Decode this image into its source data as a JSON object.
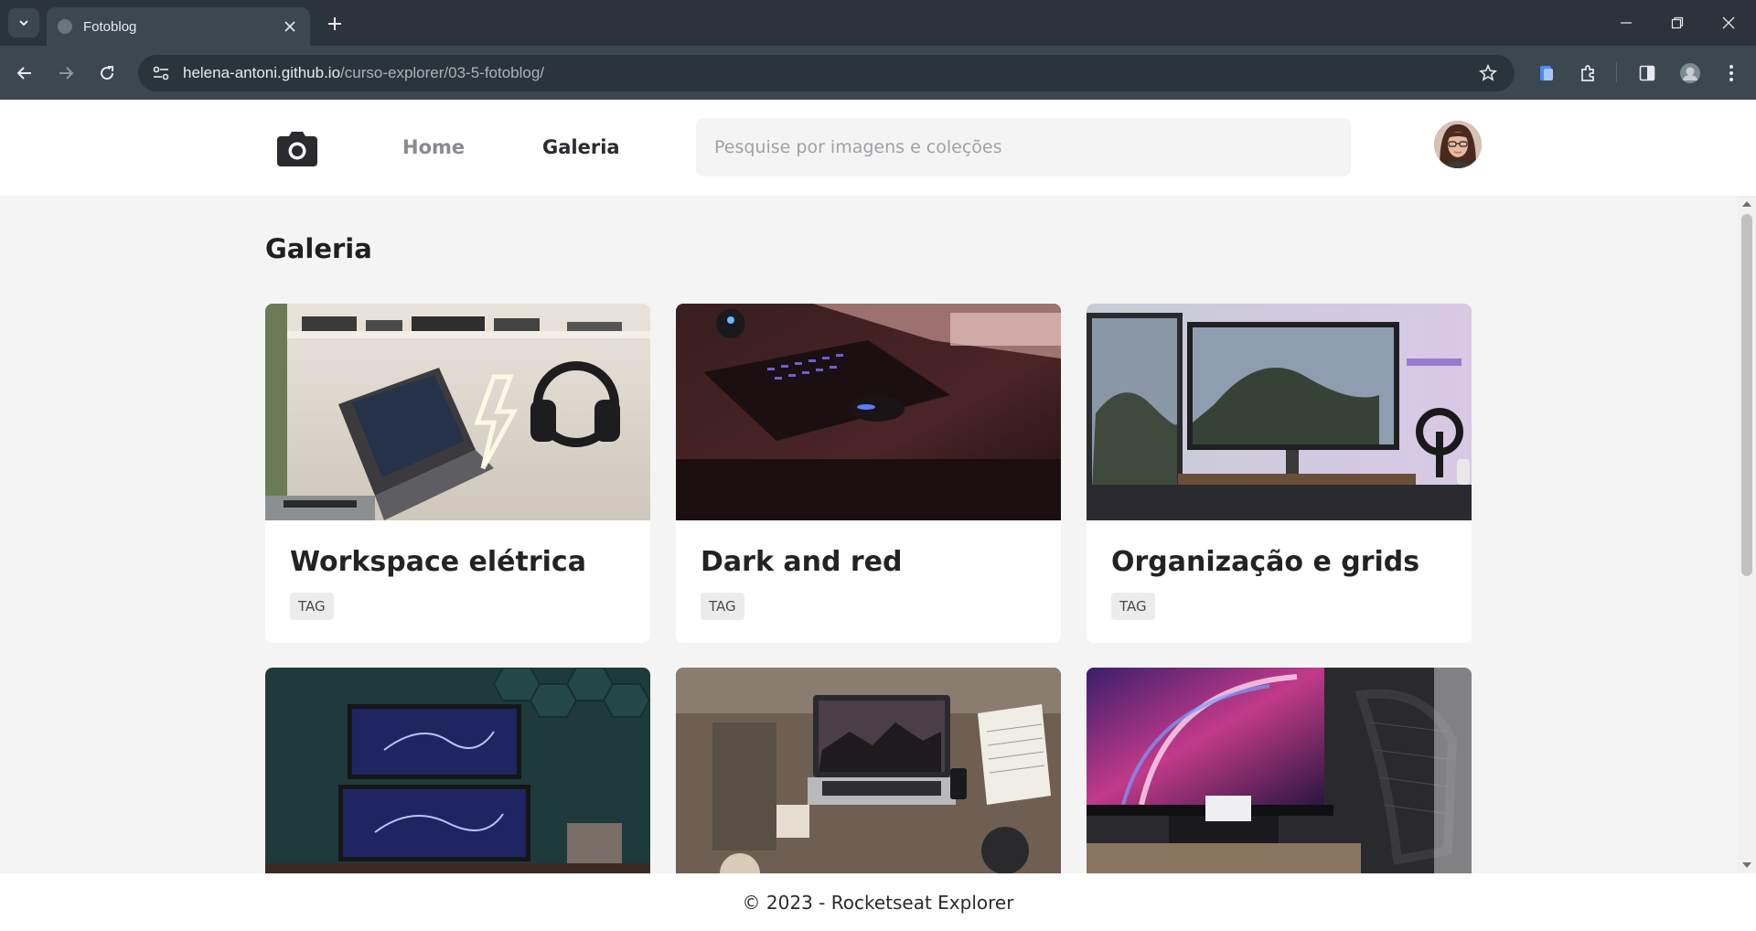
{
  "browser": {
    "tab_title": "Fotoblog",
    "url_host": "helena-antoni.github.io",
    "url_path": "/curso-explorer/03-5-fotoblog/"
  },
  "header": {
    "nav": [
      {
        "label": "Home",
        "active": false
      },
      {
        "label": "Galeria",
        "active": true
      }
    ],
    "search_placeholder": "Pesquise por imagens e coleções"
  },
  "main": {
    "title": "Galeria",
    "cards": [
      {
        "title": "Workspace elétrica",
        "tag": "TAG",
        "image": "desk-with-laptop-headphones-neon-bolt"
      },
      {
        "title": "Dark and red",
        "tag": "TAG",
        "image": "dark-red-keyboard-mouse"
      },
      {
        "title": "Organização e grids",
        "tag": "TAG",
        "image": "dual-monitors-headphone-stand"
      },
      {
        "title": "",
        "tag": "",
        "image": "teal-wall-stacked-monitors"
      },
      {
        "title": "",
        "tag": "",
        "image": "top-down-desk-laptop-notebook"
      },
      {
        "title": "",
        "tag": "",
        "image": "purple-wallpaper-monitor-chair"
      }
    ]
  },
  "footer": {
    "text": "© 2023 - Rocketseat Explorer"
  },
  "colors": {
    "chrome_dark": "#2a353b",
    "chrome_mid": "#3b484f",
    "page_bg": "#f4f4f4",
    "card_bg": "#ffffff",
    "text_dark": "#232326",
    "nav_muted": "#8a8a90"
  }
}
